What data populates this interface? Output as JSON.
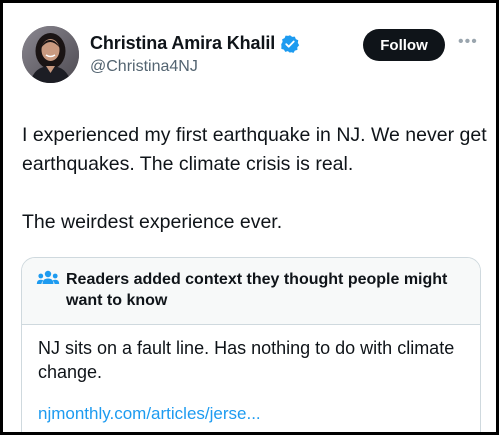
{
  "author": {
    "display_name": "Christina Amira Khalil",
    "handle": "@Christina4NJ",
    "verified_color": "#1d9bf0"
  },
  "actions": {
    "follow_label": "Follow",
    "more_icon": "more-icon"
  },
  "tweet": {
    "paragraphs": [
      "I experienced my first earthquake in NJ. We never get earthquakes. The climate crisis is real.",
      "The weirdest experience ever."
    ]
  },
  "community_note": {
    "icon": "people-icon",
    "title": "Readers added context they thought people might want to know",
    "body": "NJ sits on a fault line. Has nothing to do with climate change.",
    "link_text": "njmonthly.com/articles/jerse..."
  },
  "colors": {
    "accent": "#1d9bf0",
    "follow_bg": "#0f1419",
    "text": "#0f1419",
    "muted": "#536471",
    "note_header_bg": "#f7f9f9"
  }
}
